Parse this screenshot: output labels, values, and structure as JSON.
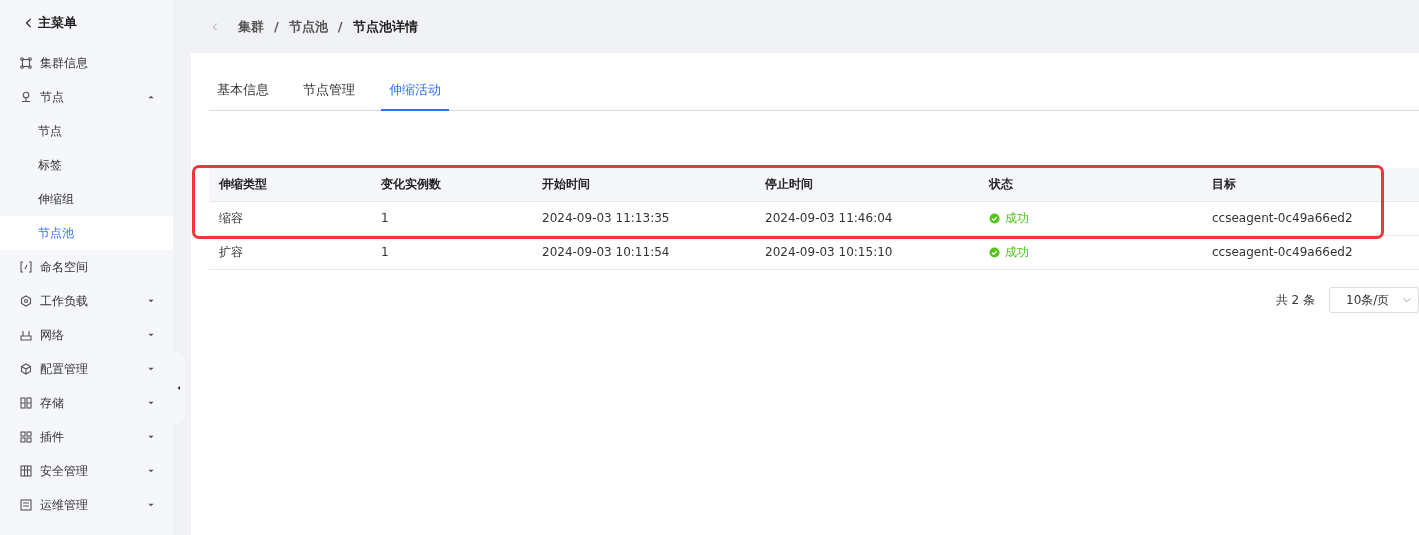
{
  "sidebar": {
    "back_label": "主菜单",
    "items": [
      {
        "label": "集群信息"
      },
      {
        "label": "节点",
        "expanded": true,
        "children": [
          {
            "label": "节点",
            "selected": false
          },
          {
            "label": "标签",
            "selected": false
          },
          {
            "label": "伸缩组",
            "selected": false
          },
          {
            "label": "节点池",
            "selected": true
          }
        ]
      },
      {
        "label": "命名空间"
      },
      {
        "label": "工作负载",
        "expanded": false
      },
      {
        "label": "网络",
        "expanded": false
      },
      {
        "label": "配置管理",
        "expanded": false
      },
      {
        "label": "存储",
        "expanded": false
      },
      {
        "label": "插件",
        "expanded": false
      },
      {
        "label": "安全管理",
        "expanded": false
      },
      {
        "label": "运维管理",
        "expanded": false
      }
    ]
  },
  "breadcrumb": {
    "separator": "/",
    "items": [
      "集群",
      "节点池",
      "节点池详情"
    ]
  },
  "tabs": [
    {
      "label": "基本信息",
      "selected": false
    },
    {
      "label": "节点管理",
      "selected": false
    },
    {
      "label": "伸缩活动",
      "selected": true
    }
  ],
  "table": {
    "columns": [
      "伸缩类型",
      "变化实例数",
      "开始时间",
      "停止时间",
      "状态",
      "目标"
    ],
    "rows": [
      {
        "highlighted": true,
        "cells": [
          "缩容",
          "1",
          "2024-09-03 11:13:35",
          "2024-09-03 11:46:04",
          "成功",
          "ccseagent-0c49a66ed2"
        ]
      },
      {
        "highlighted": false,
        "cells": [
          "扩容",
          "1",
          "2024-09-03 10:11:54",
          "2024-09-03 10:15:10",
          "成功",
          "ccseagent-0c49a66ed2"
        ]
      }
    ]
  },
  "pagination": {
    "total": "共 2 条",
    "page_size": "10条/页"
  }
}
